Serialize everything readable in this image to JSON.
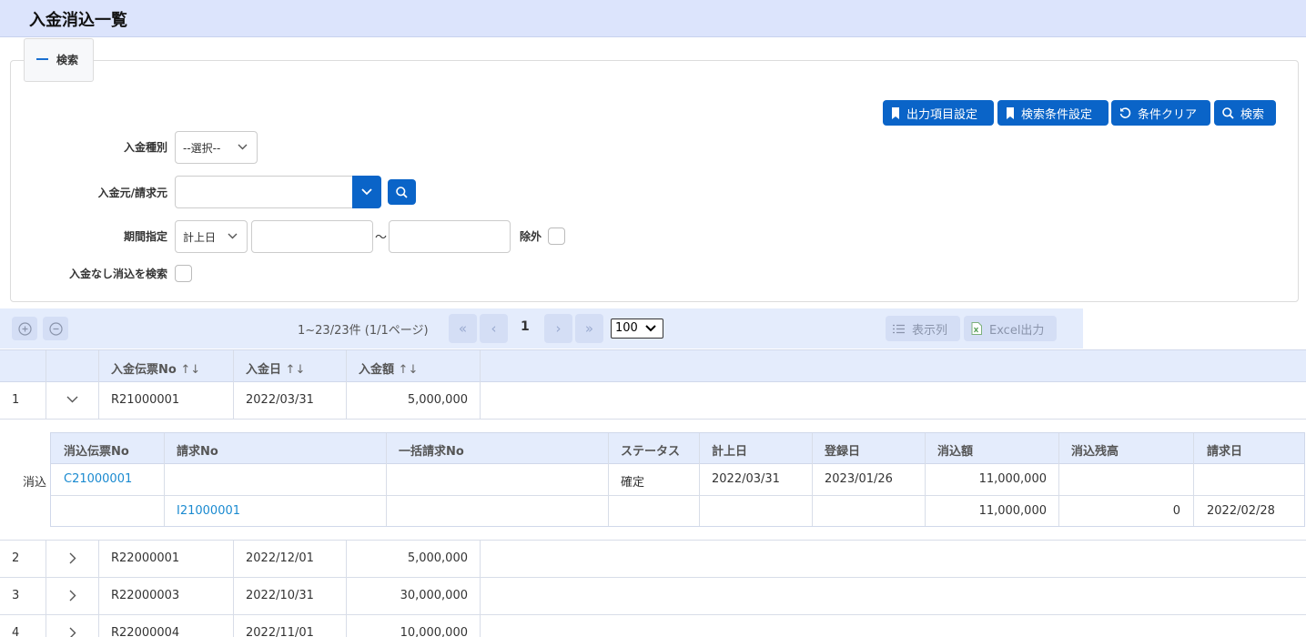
{
  "page": {
    "title": "入金消込一覧"
  },
  "search": {
    "tab_label": "検索",
    "buttons": {
      "output_settings": "出力項目設定",
      "condition_settings": "検索条件設定",
      "clear": "条件クリア",
      "search": "検索"
    },
    "payment_type_label": "入金種別",
    "payment_type_value": "--選択--",
    "source_label": "入金元/請求元",
    "period_label": "期間指定",
    "period_type_value": "計上日",
    "tilde": "～",
    "exclude_label": "除外",
    "no_payment_label": "入金なし消込を検索"
  },
  "toolbar": {
    "pager_info": "1~23/23件 (1/1ページ)",
    "current_page": "1",
    "page_size": "100",
    "columns_label": "表示列",
    "excel_label": "Excel出力"
  },
  "grid": {
    "columns": [
      "入金伝票No",
      "入金日",
      "入金額"
    ],
    "sort_icon": "↑↓",
    "rows": [
      {
        "index": "1",
        "slip": "R21000001",
        "date": "2022/03/31",
        "amount": "5,000,000"
      },
      {
        "index": "2",
        "slip": "R22000001",
        "date": "2022/12/01",
        "amount": "5,000,000"
      },
      {
        "index": "3",
        "slip": "R22000003",
        "date": "2022/10/31",
        "amount": "30,000,000"
      },
      {
        "index": "4",
        "slip": "R22000004",
        "date": "2022/11/01",
        "amount": "10,000,000"
      }
    ]
  },
  "detail": {
    "row_label": "消込",
    "columns": [
      "消込伝票No",
      "請求No",
      "一括請求No",
      "ステータス",
      "計上日",
      "登録日",
      "消込額",
      "消込残高",
      "請求日"
    ],
    "rows": [
      {
        "slip": "C21000001",
        "invoice": "",
        "bulk": "",
        "status": "確定",
        "post_date": "2022/03/31",
        "reg_date": "2023/01/26",
        "amount": "11,000,000",
        "balance": "",
        "invoice_date": ""
      },
      {
        "slip": "",
        "invoice": "I21000001",
        "bulk": "",
        "status": "",
        "post_date": "",
        "reg_date": "",
        "amount": "11,000,000",
        "balance": "0",
        "invoice_date": "2022/02/28"
      }
    ]
  }
}
